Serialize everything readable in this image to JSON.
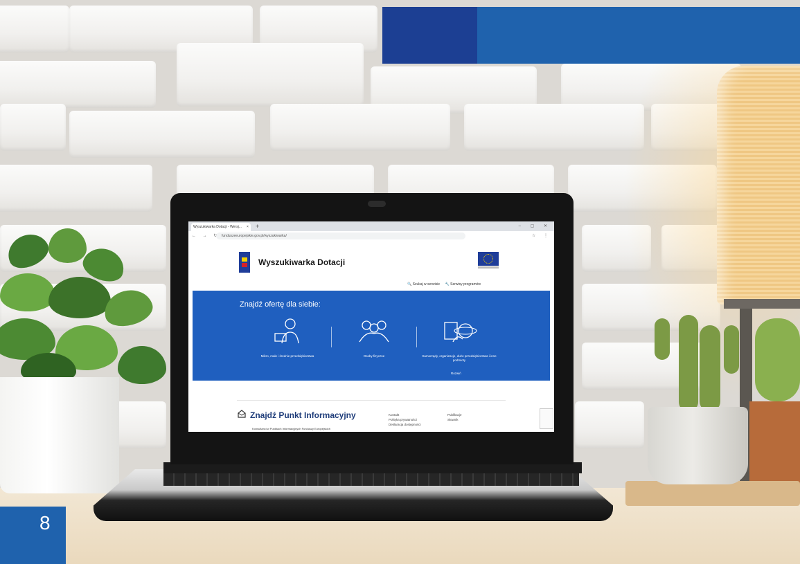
{
  "page_number": "8",
  "colors": {
    "accent_dark": "#1c3f93",
    "accent": "#1f62ad",
    "site_banner": "#1f5fbf"
  },
  "browser": {
    "tab_title": "Wyszukiwarka Dotacji - Wersj...",
    "tab_close": "×",
    "new_tab": "+",
    "url": "funduszeeuropejskie.gov.pl/wyszukiwarka/"
  },
  "site": {
    "title": "Wyszukiwarka Dotacji",
    "top_links": [
      "Szukaj w serwisie",
      "Serwisy programów"
    ],
    "banner_title": "Znajdź ofertę dla siebie:",
    "categories": [
      {
        "label": "Mikro, małe i średnie przedsiębiorstwa",
        "icon": "entrepreneur-icon"
      },
      {
        "label": "Osoby fizyczne",
        "icon": "people-icon"
      },
      {
        "label": "Samorządy, organizacje, duże przedsiębiorstwa i inne podmioty",
        "icon": "institutions-icon"
      }
    ],
    "more_label": "Rozwiń",
    "info_point_title": "Znajdź Punkt Informacyjny",
    "info_point_sub": "Konsultanci w Punktach Informacyjnych Funduszy Europejskich",
    "footer_col1": [
      "Kontakt",
      "Polityka prywatności",
      "Deklaracja dostępności"
    ],
    "footer_col2": [
      "Publikacje",
      "Słownik"
    ]
  }
}
